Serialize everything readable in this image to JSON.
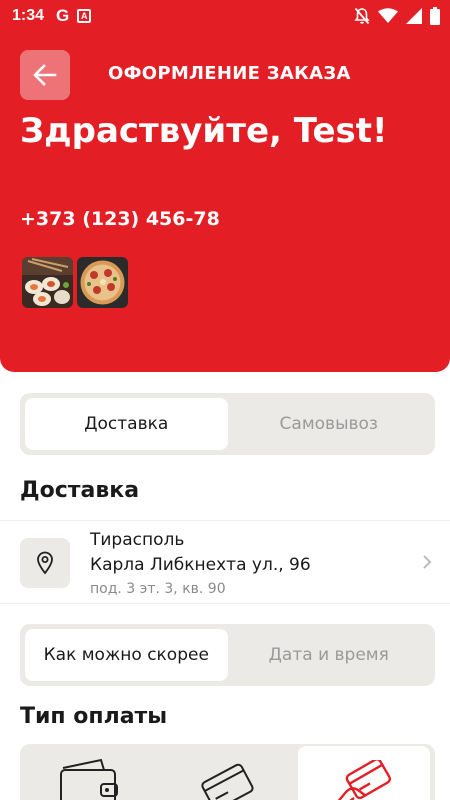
{
  "status_bar": {
    "time": "1:34",
    "left_icons": [
      "google-g-icon",
      "a-badge-icon"
    ],
    "right_icons": [
      "bell-off-icon",
      "wifi-icon",
      "signal-icon",
      "battery-icon"
    ]
  },
  "header": {
    "title": "ОФОРМЛЕНИЕ ЗАКАЗА",
    "greeting": "Здраствуйте, Test!",
    "phone": "+373 (123) 456-78",
    "background_color": "#e31e24",
    "order_items": [
      "sushi-rolls-thumbnail",
      "pizza-thumbnail"
    ]
  },
  "delivery_method": {
    "options": [
      "Доставка",
      "Самовывоз"
    ],
    "selected": "Доставка"
  },
  "delivery_section": {
    "title": "Доставка",
    "address": {
      "city": "Тирасполь",
      "street": "Карла Либкнехта ул., 96",
      "details": "под. 3 эт. 3, кв. 90"
    }
  },
  "time_choice": {
    "options": [
      "Как можно скорее",
      "Дата и время"
    ],
    "selected": "Как можно скорее"
  },
  "payment": {
    "title": "Тип оплаты",
    "options": [
      "wallet-icon",
      "card-icon",
      "card-in-hand-icon"
    ],
    "selected": "card-in-hand-icon"
  }
}
